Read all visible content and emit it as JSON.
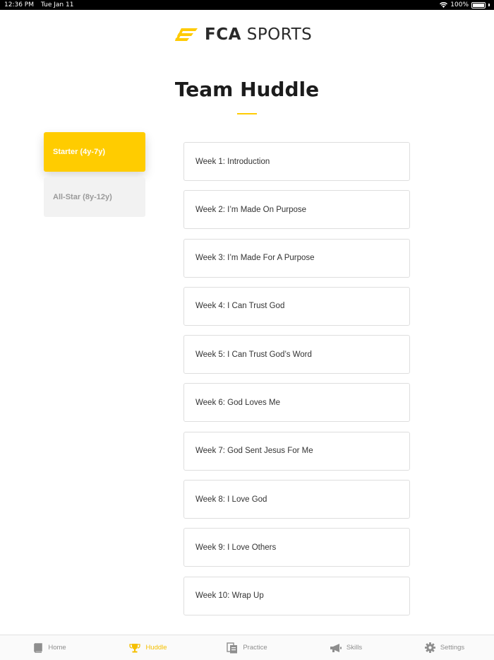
{
  "status_bar": {
    "time": "12:36 PM",
    "date": "Tue Jan 11",
    "battery": "100%"
  },
  "brand": {
    "name_bold": "FCA",
    "name_light": " SPORTS",
    "accent_color": "#ffcb05"
  },
  "page": {
    "title": "Team Huddle"
  },
  "levels": [
    {
      "label": "Starter (4y-7y)",
      "selected": true
    },
    {
      "label": "All-Star (8y-12y)",
      "selected": false
    }
  ],
  "weeks": [
    "Week 1: Introduction",
    "Week 2: I’m Made On Purpose",
    "Week 3: I’m Made For A Purpose",
    "Week 4: I Can Trust God",
    "Week 5: I Can Trust God’s Word",
    "Week 6: God Loves Me",
    "Week 7: God Sent Jesus For Me",
    "Week 8: I Love God",
    "Week 9: I Love Others",
    "Week 10: Wrap Up"
  ],
  "tab_bar": [
    {
      "label": "Home",
      "icon": "book-icon",
      "active": false
    },
    {
      "label": "Huddle",
      "icon": "trophy-icon",
      "active": true
    },
    {
      "label": "Practice",
      "icon": "clipboard-icon",
      "active": false
    },
    {
      "label": "Skills",
      "icon": "megaphone-icon",
      "active": false
    },
    {
      "label": "Settings",
      "icon": "gear-icon",
      "active": false
    }
  ]
}
